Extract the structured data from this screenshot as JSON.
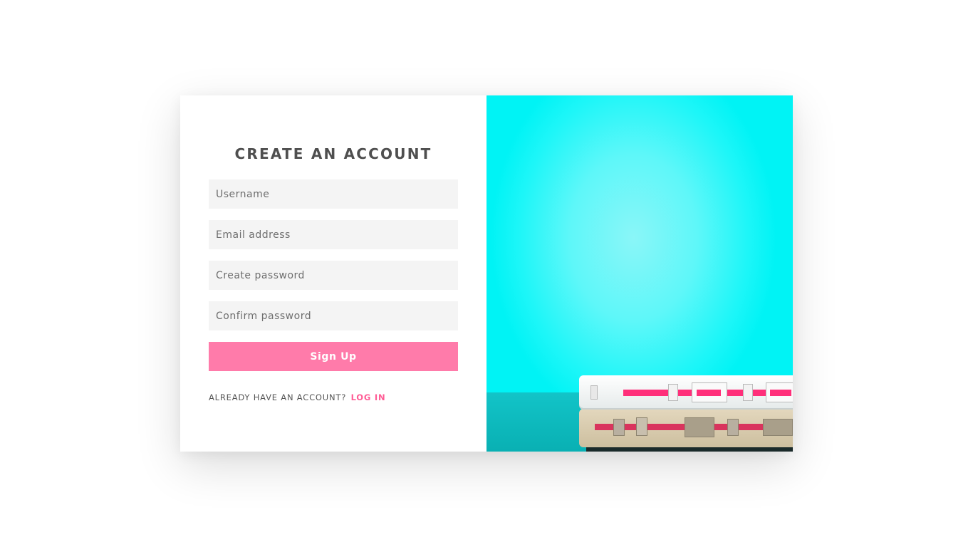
{
  "form": {
    "title": "CREATE AN ACCOUNT",
    "fields": [
      {
        "placeholder": "Username"
      },
      {
        "placeholder": "Email address"
      },
      {
        "placeholder": "Create password"
      },
      {
        "placeholder": "Confirm password"
      }
    ],
    "submit_label": "Sign Up",
    "footer_text": "ALREADY HAVE AN ACCOUNT?",
    "footer_link": "LOG IN"
  },
  "colors": {
    "accent": "#ff7baa",
    "link": "#ff5c95",
    "field_bg": "#f4f4f4",
    "image_bg": "#00f3f5"
  },
  "image": {
    "subject": "stacked-cassette-tapes"
  }
}
